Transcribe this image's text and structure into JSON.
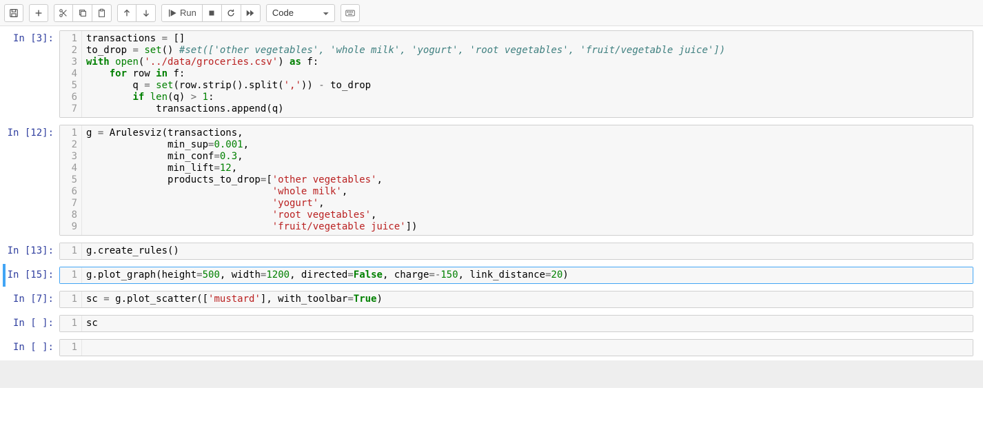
{
  "toolbar": {
    "save_title": "Save and Checkpoint",
    "insert_title": "insert cell below",
    "cut_title": "cut selected cells",
    "copy_title": "copy selected cells",
    "paste_title": "paste cells below",
    "moveup_title": "move selected cells up",
    "movedown_title": "move selected cells down",
    "run_label": "Run",
    "run_title": "run cell, select below",
    "interrupt_title": "interrupt the kernel",
    "restart_title": "restart the kernel",
    "restartrun_title": "restart the kernel, then re-run the whole notebook",
    "celltype_value": "Code",
    "cmdpalette_title": "open the command palette"
  },
  "cells": [
    {
      "prompt": "In [3]:",
      "lines": [
        "1",
        "2",
        "3",
        "4",
        "5",
        "6",
        "7"
      ],
      "code_html": "transactions <span class='o'>=</span> []\nto_drop <span class='o'>=</span> <span class='nb'>set</span>() <span class='c'>#set(['other vegetables', 'whole milk', 'yogurt', 'root vegetables', 'fruit/vegetable juice'])</span>\n<span class='k'>with</span> <span class='nb'>open</span>(<span class='s'>'../data/groceries.csv'</span>) <span class='k'>as</span> f:\n    <span class='k'>for</span> row <span class='k'>in</span> f:\n        q <span class='o'>=</span> <span class='nb'>set</span>(row.strip().split(<span class='s'>','</span>)) <span class='o'>-</span> to_drop\n        <span class='k'>if</span> <span class='nb'>len</span>(q) <span class='o'>&gt;</span> <span class='m'>1</span>:\n            transactions.append(q)",
      "selected": false
    },
    {
      "prompt": "In [12]:",
      "lines": [
        "1",
        "2",
        "3",
        "4",
        "5",
        "6",
        "7",
        "8",
        "9"
      ],
      "code_html": "g <span class='o'>=</span> Arulesviz(transactions,\n              min_sup<span class='o'>=</span><span class='m'>0.001</span>,\n              min_conf<span class='o'>=</span><span class='m'>0.3</span>,\n              min_lift<span class='o'>=</span><span class='m'>12</span>,\n              products_to_drop<span class='o'>=</span>[<span class='s'>'other vegetables'</span>,\n                                <span class='s'>'whole milk'</span>,\n                                <span class='s'>'yogurt'</span>,\n                                <span class='s'>'root vegetables'</span>,\n                                <span class='s'>'fruit/vegetable juice'</span>])",
      "selected": false
    },
    {
      "prompt": "In [13]:",
      "lines": [
        "1"
      ],
      "code_html": "g.create_rules()",
      "selected": false
    },
    {
      "prompt": "In [15]:",
      "lines": [
        "1"
      ],
      "code_html": "g.plot_graph(height<span class='o'>=</span><span class='m'>500</span>, width<span class='o'>=</span><span class='m'>1200</span>, directed<span class='o'>=</span><span class='bp'>False</span>, charge<span class='o'>=-</span><span class='m'>150</span>, link_distance<span class='o'>=</span><span class='m'>20</span>)",
      "selected": true
    },
    {
      "prompt": "In [7]:",
      "lines": [
        "1"
      ],
      "code_html": "sc <span class='o'>=</span> g.plot_scatter([<span class='s'>'mustard'</span>], with_toolbar<span class='o'>=</span><span class='bp'>True</span>)",
      "selected": false
    },
    {
      "prompt": "In [ ]:",
      "lines": [
        "1"
      ],
      "code_html": "sc",
      "selected": false
    },
    {
      "prompt": "In [ ]:",
      "lines": [
        "1"
      ],
      "code_html": "",
      "selected": false
    }
  ]
}
